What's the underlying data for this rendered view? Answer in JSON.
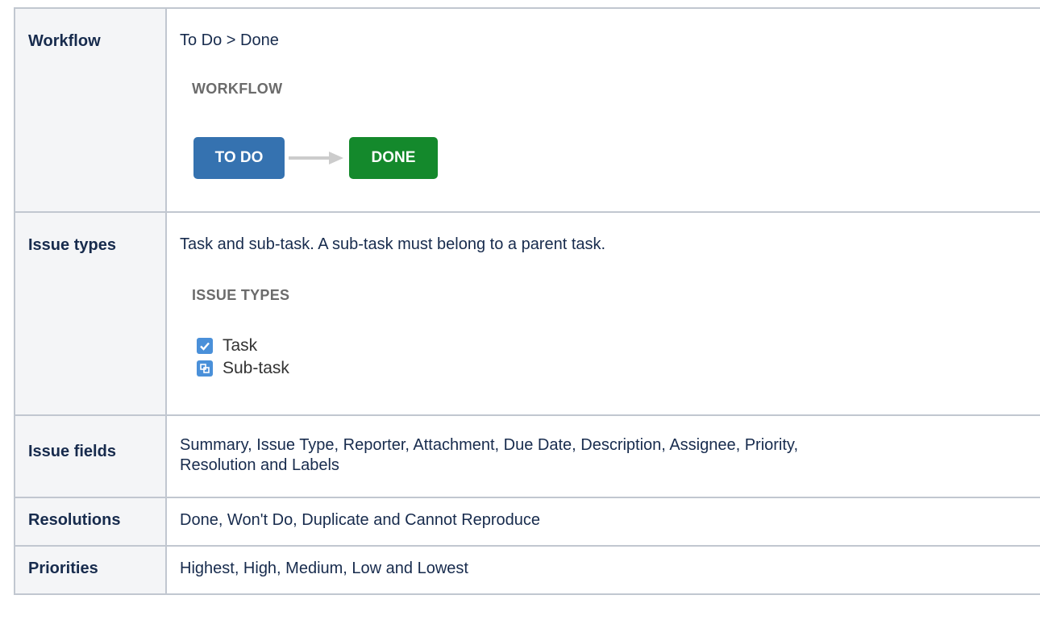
{
  "rows": {
    "workflow": {
      "header": "Workflow",
      "summary": "To Do > Done",
      "diagram_heading": "WORKFLOW",
      "status_from": "TO DO",
      "status_to": "DONE",
      "status_from_color": "#3572b0",
      "status_to_color": "#14892c"
    },
    "issue_types": {
      "header": "Issue types",
      "summary": "Task and sub-task. A sub-task must belong to a parent task.",
      "list_heading": "ISSUE TYPES",
      "items": [
        {
          "label": "Task",
          "icon": "checkbox-icon"
        },
        {
          "label": "Sub-task",
          "icon": "subtask-icon"
        }
      ]
    },
    "issue_fields": {
      "header": "Issue fields",
      "value_line1": "Summary, Issue Type, Reporter, Attachment, Due Date, Description, Assignee, Priority,",
      "value_line2": "Resolution and Labels"
    },
    "resolutions": {
      "header": "Resolutions",
      "value": "Done, Won't Do, Duplicate and Cannot Reproduce"
    },
    "priorities": {
      "header": "Priorities",
      "value": "Highest, High, Medium, Low and Lowest"
    }
  }
}
